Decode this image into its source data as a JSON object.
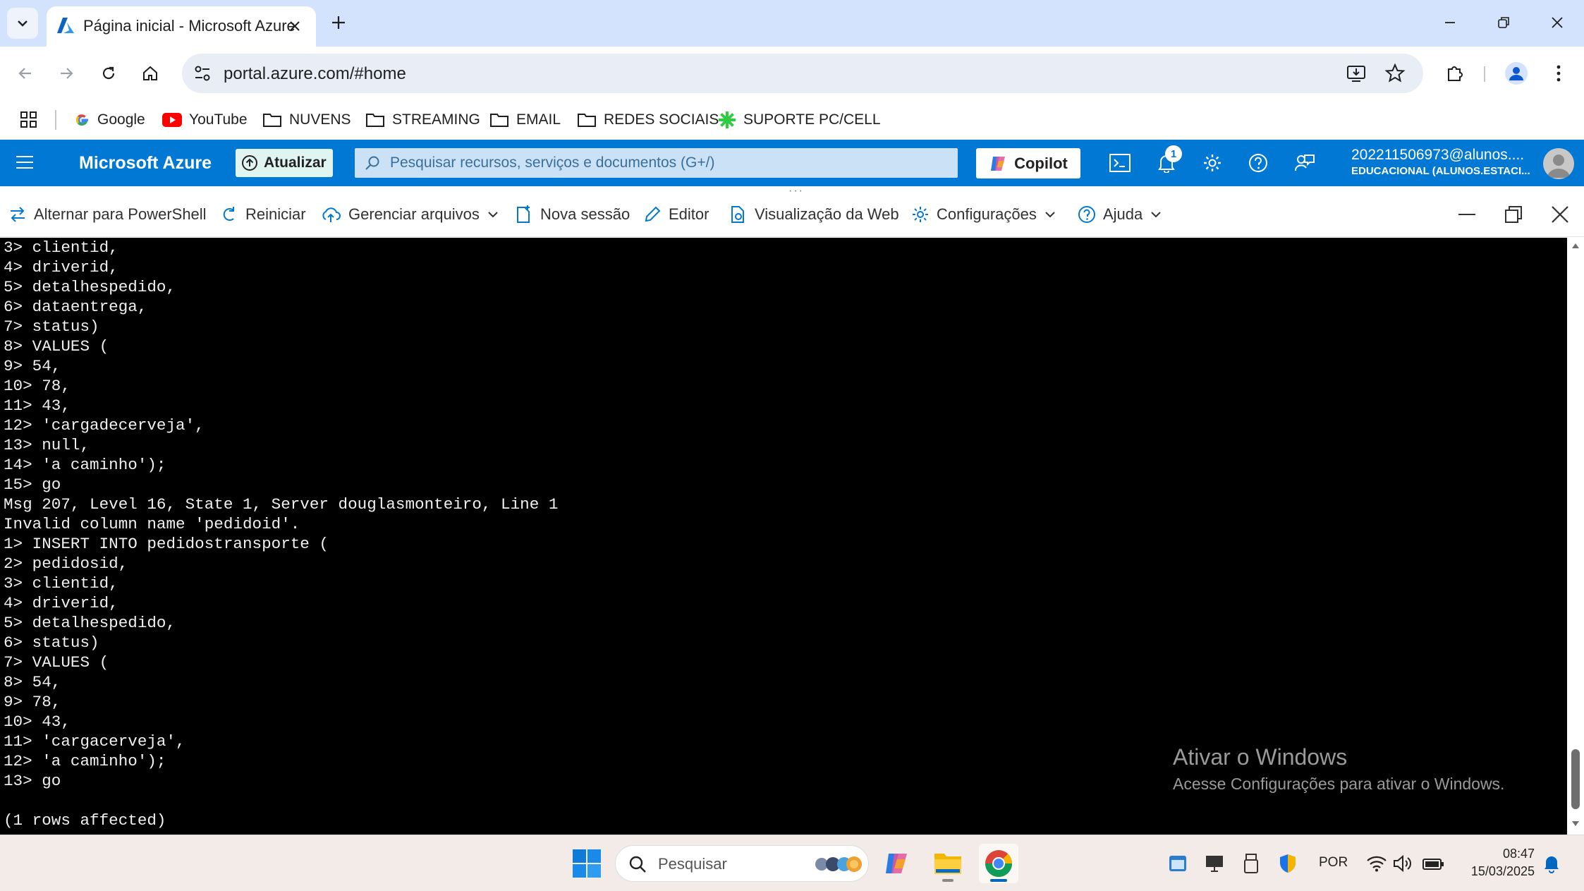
{
  "browser": {
    "tab_title": "Página inicial - Microsoft Azure",
    "url": "portal.azure.com/#home",
    "bookmarks": [
      {
        "label": "Google",
        "icon": "google-icon"
      },
      {
        "label": "YouTube",
        "icon": "youtube-icon"
      },
      {
        "label": "NUVENS",
        "icon": "folder-icon"
      },
      {
        "label": "STREAMING",
        "icon": "folder-icon"
      },
      {
        "label": "EMAIL",
        "icon": "folder-icon"
      },
      {
        "label": "REDES SOCIAIS",
        "icon": "folder-icon"
      },
      {
        "label": "SUPORTE PC/CELL",
        "icon": "star-burst-icon"
      }
    ]
  },
  "azure_header": {
    "brand": "Microsoft Azure",
    "upgrade_label": "Atualizar",
    "search_placeholder": "Pesquisar recursos, serviços e documentos (G+/)",
    "copilot_label": "Copilot",
    "notification_count": "1",
    "account_name": "202211506973@alunos....",
    "account_directory": "EDUCACIONAL (ALUNOS.ESTACI..."
  },
  "shell_toolbar": {
    "powershell": "Alternar para PowerShell",
    "restart": "Reiniciar",
    "manage_files": "Gerenciar arquivos",
    "new_session": "Nova sessão",
    "editor": "Editor",
    "web_preview": "Visualização da Web",
    "settings": "Configurações",
    "help": "Ajuda"
  },
  "terminal": {
    "lines": [
      "3> clientid,",
      "4> driverid,",
      "5> detalhespedido,",
      "6> dataentrega,",
      "7> status)",
      "8> VALUES (",
      "9> 54,",
      "10> 78,",
      "11> 43,",
      "12> 'cargadecerveja',",
      "13> null,",
      "14> 'a caminho');",
      "15> go",
      "Msg 207, Level 16, State 1, Server douglasmonteiro, Line 1",
      "Invalid column name 'pedidoid'.",
      "1> INSERT INTO pedidostransporte (",
      "2> pedidosid,",
      "3> clientid,",
      "4> driverid,",
      "5> detalhespedido,",
      "6> status)",
      "7> VALUES (",
      "8> 54,",
      "9> 78,",
      "10> 43,",
      "11> 'cargacerveja',",
      "12> 'a caminho');",
      "13> go",
      "",
      "(1 rows affected)"
    ]
  },
  "watermark": {
    "title": "Ativar o Windows",
    "subtitle": "Acesse Configurações para ativar o Windows."
  },
  "taskbar": {
    "search_placeholder": "Pesquisar",
    "language": "POR",
    "time": "08:47",
    "date": "15/03/2025"
  },
  "colors": {
    "azure_blue": "#0078d4",
    "tab_strip": "#d3e3fd",
    "terminal_bg": "#000000"
  }
}
